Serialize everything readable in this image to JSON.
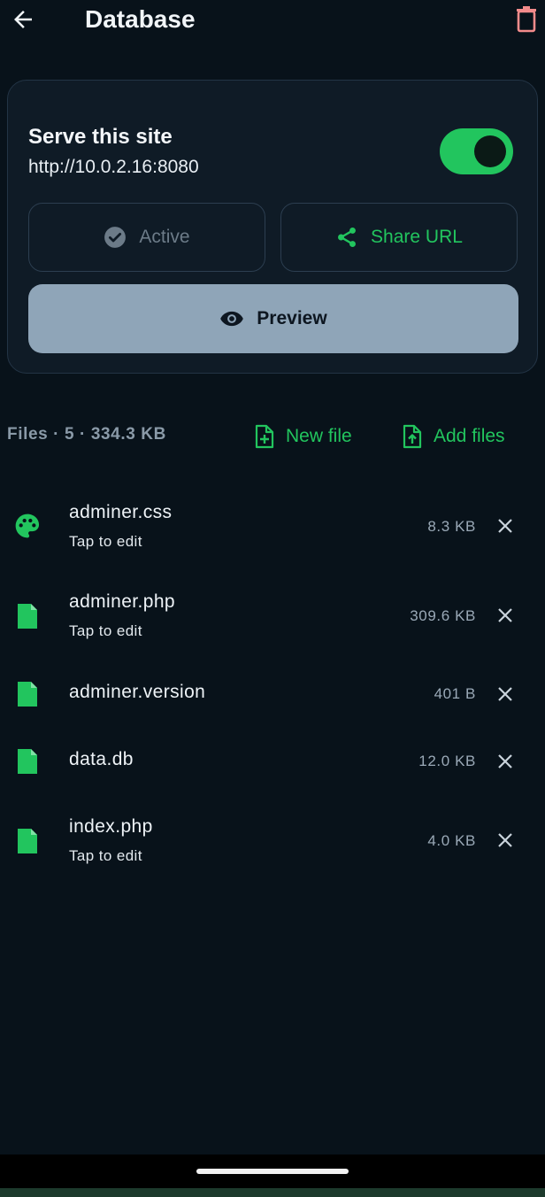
{
  "header": {
    "title": "Database",
    "back_icon": "arrow-left-icon",
    "delete_icon": "trash-icon"
  },
  "serve": {
    "title": "Serve this site",
    "url": "http://10.0.2.16:8080",
    "toggle_on": true,
    "active_label": "Active",
    "share_label": "Share URL",
    "preview_label": "Preview"
  },
  "files_header": {
    "summary": "Files · 5 · 334.3 KB",
    "new_file_label": "New file",
    "add_files_label": "Add files"
  },
  "files": [
    {
      "name": "adminer.css",
      "subtitle": "Tap to edit",
      "size": "8.3 KB",
      "icon": "palette-icon"
    },
    {
      "name": "adminer.php",
      "subtitle": "Tap to edit",
      "size": "309.6 KB",
      "icon": "file-icon"
    },
    {
      "name": "adminer.version",
      "subtitle": "",
      "size": "401 B",
      "icon": "file-icon"
    },
    {
      "name": "data.db",
      "subtitle": "",
      "size": "12.0 KB",
      "icon": "file-icon"
    },
    {
      "name": "index.php",
      "subtitle": "Tap to edit",
      "size": "4.0 KB",
      "icon": "file-icon"
    }
  ],
  "colors": {
    "accent": "#22c55e",
    "background": "#08121a",
    "card": "#0f1b26",
    "danger": "#f28b8b",
    "preview_button": "#8fa5b8"
  }
}
